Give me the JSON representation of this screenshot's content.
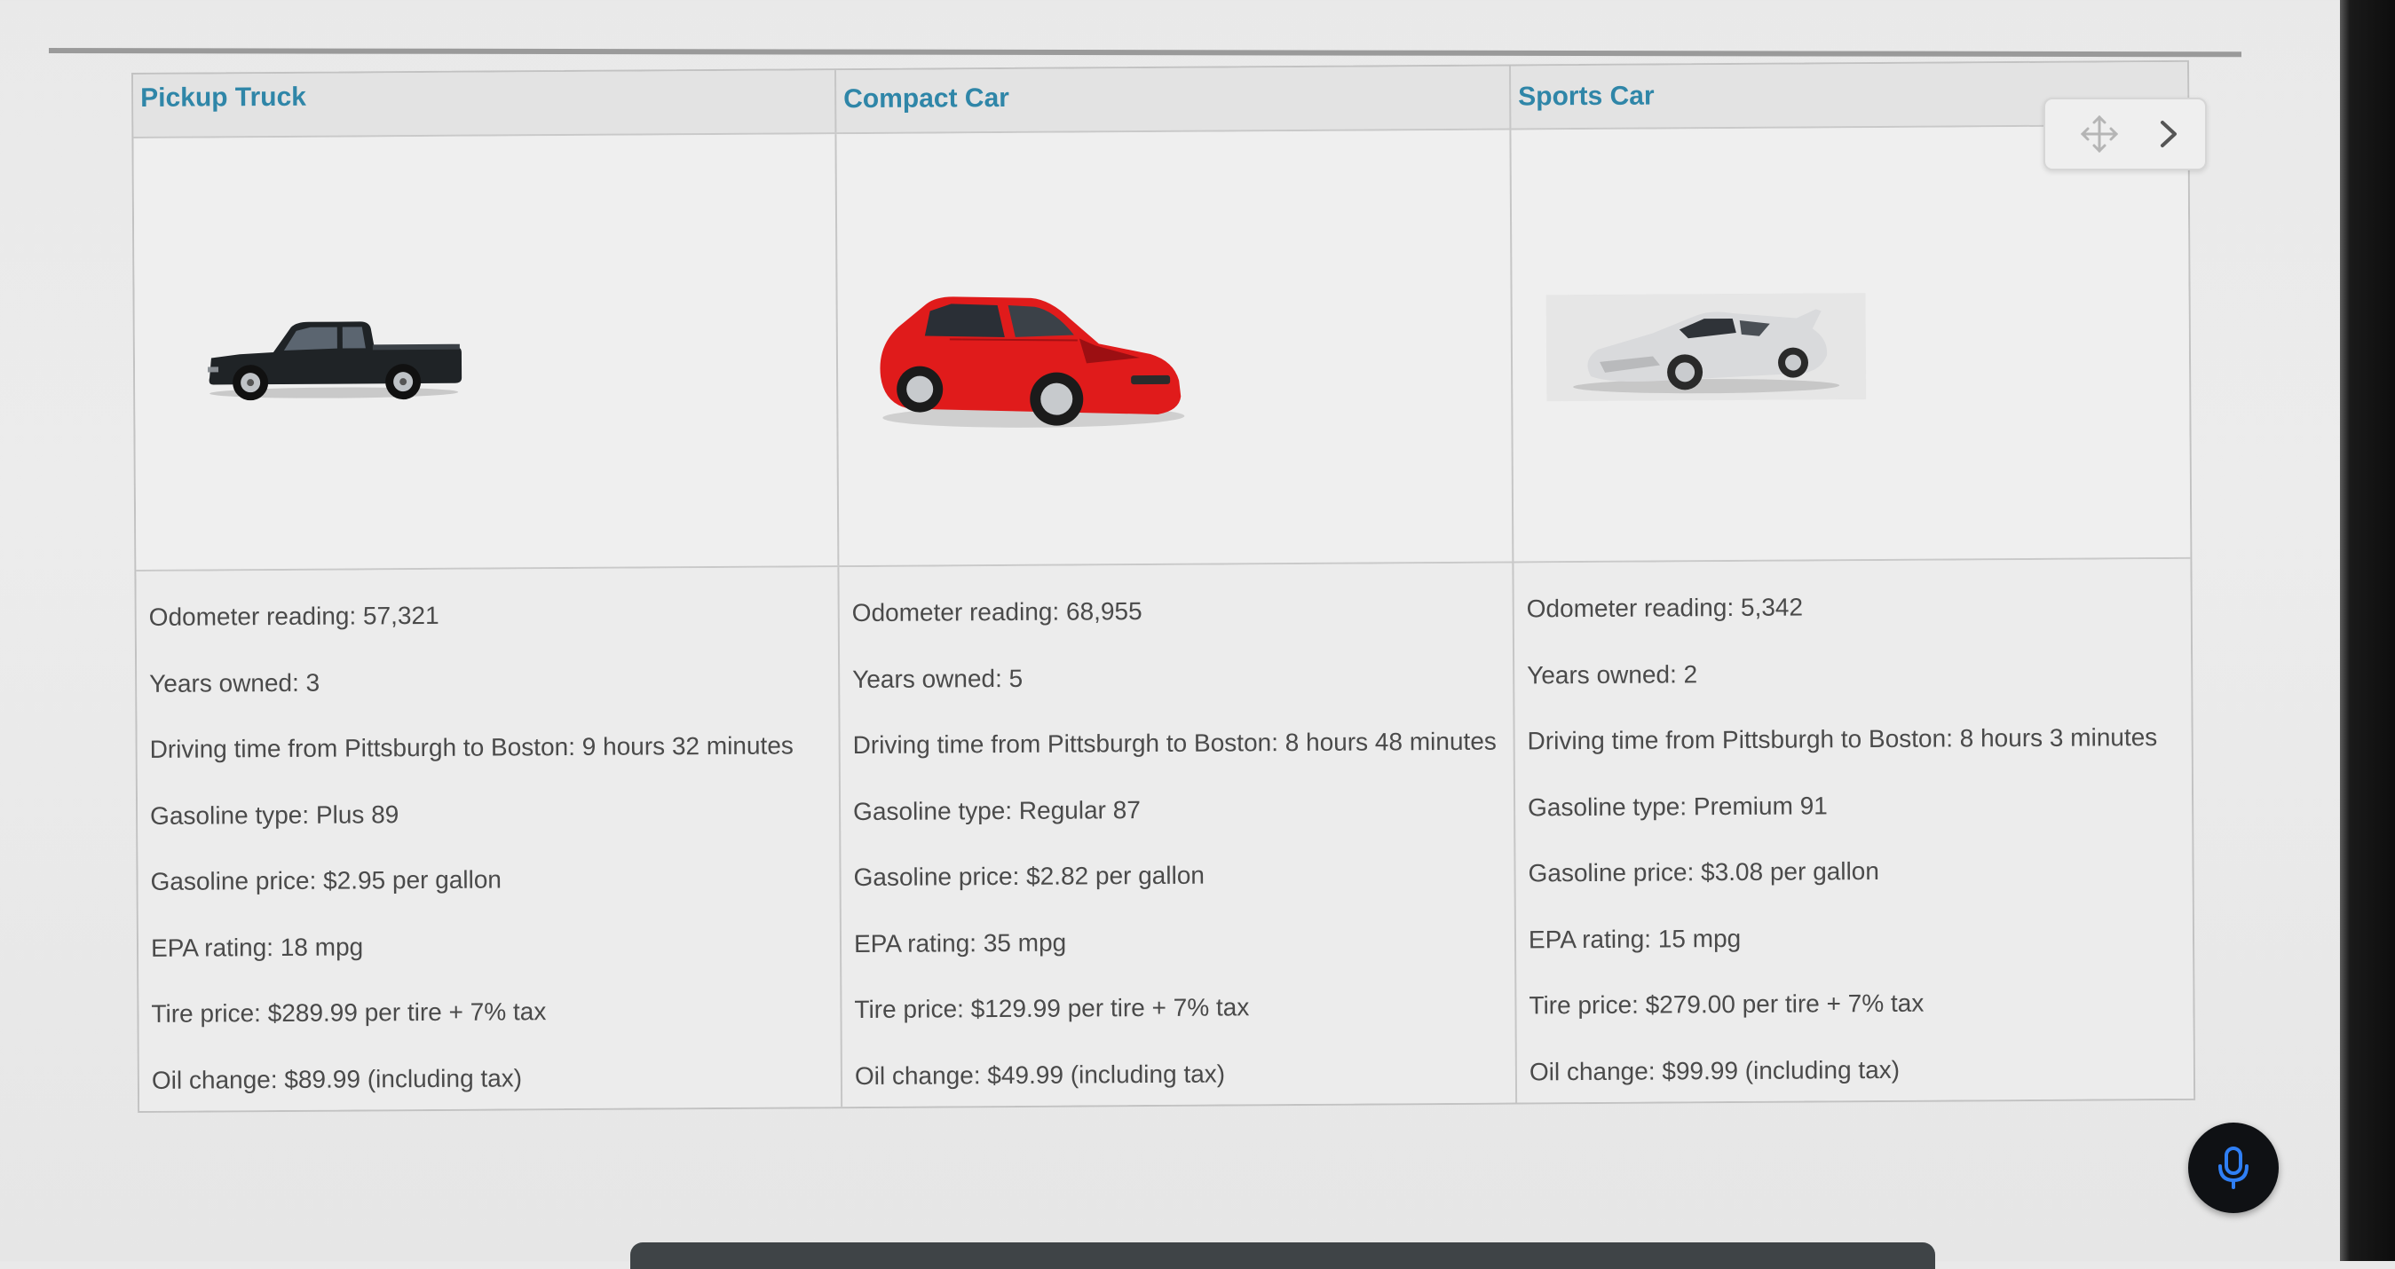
{
  "table": {
    "columns": [
      {
        "title": "Pickup Truck",
        "image_icon": "pickup-truck-image",
        "body_color": "#1f2326",
        "specs": [
          "Odometer reading: 57,321",
          "Years owned: 3",
          "Driving time from Pittsburgh to Boston: 9 hours 32 minutes",
          "Gasoline type: Plus 89",
          "Gasoline price: $2.95 per gallon",
          "EPA rating: 18 mpg",
          "Tire price: $289.99 per tire + 7% tax",
          "Oil change: $89.99 (including tax)"
        ]
      },
      {
        "title": "Compact Car",
        "image_icon": "compact-car-image",
        "body_color": "#e01b1b",
        "specs": [
          "Odometer reading: 68,955",
          "Years owned: 5",
          "Driving time from Pittsburgh to Boston: 8 hours 48 minutes",
          "Gasoline type: Regular 87",
          "Gasoline price: $2.82 per gallon",
          "EPA rating: 35 mpg",
          "Tire price: $129.99 per tire + 7% tax",
          "Oil change: $49.99 (including tax)"
        ]
      },
      {
        "title": "Sports Car",
        "image_icon": "sports-car-image",
        "body_color": "#d9dadc",
        "specs": [
          "Odometer reading: 5,342",
          "Years owned: 2",
          "Driving time from Pittsburgh to Boston: 8 hours 3 minutes",
          "Gasoline type: Premium 91",
          "Gasoline price: $3.08 per gallon",
          "EPA rating: 15 mpg",
          "Tire price: $279.00 per tire + 7% tax",
          "Oil change: $99.99 (including tax)"
        ]
      }
    ]
  },
  "widget": {
    "move_icon": "move-arrows-icon",
    "next_icon": "chevron-right-icon"
  },
  "assistant": {
    "mic_icon": "microphone-icon",
    "accent_color": "#2f7ff5"
  },
  "colors": {
    "header_text": "#2f86a8",
    "body_text": "#4a4a4a"
  }
}
